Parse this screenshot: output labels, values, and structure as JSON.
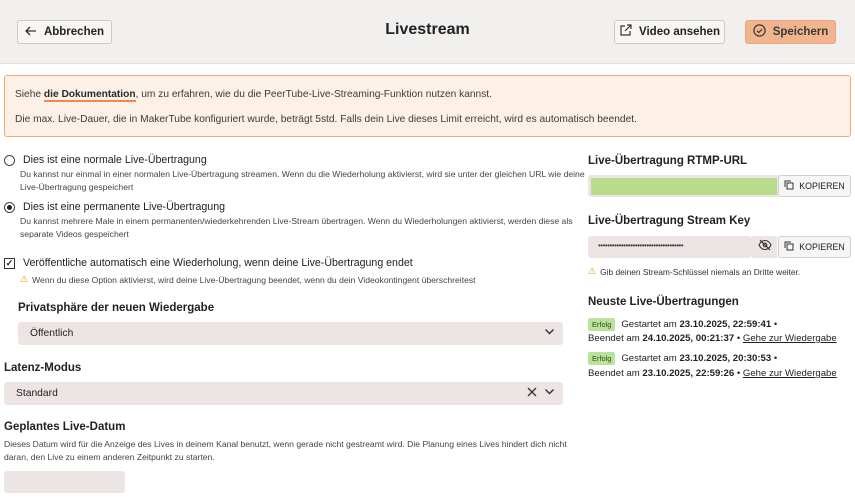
{
  "header": {
    "title": "Livestream",
    "cancel_label": "Abbrechen",
    "watch_label": "Video ansehen",
    "save_label": "Speichern"
  },
  "info": {
    "line1_prefix": "Siehe ",
    "line1_link": "die Dokumentation",
    "line1_suffix": ", um zu erfahren, wie du die PeerTube-Live-Streaming-Funktion nutzen kannst.",
    "line2": "Die max. Live-Dauer, die in MakerTube konfiguriert wurde, beträgt 5std. Falls dein Live dieses Limit erreicht, wird es automatisch beendet."
  },
  "live_type": {
    "normal_label": "Dies ist eine normale Live-Übertragung",
    "normal_desc_1": "Du kannst nur einmal in einer normalen Live-Übertragung streamen. Wenn du die Wiederholung aktivierst, wird sie unter der gleichen URL wie deine",
    "normal_desc_2": "Live-Übertragung gespeichert",
    "permanent_label": "Dies ist eine permanente Live-Übertragung",
    "permanent_desc_1": "Du kannst mehrere Male in einem permanenten/wiederkehrenden Live-Stream übertragen. Wenn du Wiederholungen aktivierst, werden diese als",
    "permanent_desc_2": "separate Videos gespeichert",
    "selected": "permanent"
  },
  "replay": {
    "label": "Veröffentliche automatisch eine Wiederholung, wenn deine Live-Übertragung endet",
    "checked": true,
    "warning": "Wenn du diese Option aktivierst, wird deine Live-Übertragung beendet, wenn du dein Videokontingent überschreitest"
  },
  "privacy": {
    "label": "Privatsphäre der neuen Wiedergabe",
    "value": "Öffentlich"
  },
  "latency": {
    "label": "Latenz-Modus",
    "value": "Standard"
  },
  "schedule": {
    "label": "Geplantes Live-Datum",
    "desc_1": "Dieses Datum wird für die Anzeige des Lives in deinem Kanal benutzt, wenn gerade nicht gestreamt wird. Die Planung eines Lives hindert dich nicht",
    "desc_2": "daran, den Live zu einem anderen Zeitpunkt zu starten.",
    "value": ""
  },
  "rtmp": {
    "label": "Live-Übertragung RTMP-URL",
    "copy_label": "KOPIEREN"
  },
  "stream_key": {
    "label": "Live-Übertragung Stream Key",
    "masked": "•••••••••••••••••••••••••••••••••••••",
    "copy_label": "KOPIEREN",
    "hint": "Gib deinen Stream-Schlüssel niemals an Dritte weiter."
  },
  "history": {
    "label": "Neuste Live-Übertragungen",
    "entries": [
      {
        "status": "Erfolg",
        "started_prefix": "Gestartet am",
        "started": "23.10.2025, 22:59:41",
        "ended_prefix": "Beendet am",
        "ended": "24.10.2025, 00:21:37",
        "link": "Gehe zur Wiedergabe"
      },
      {
        "status": "Erfolg",
        "started_prefix": "Gestartet am",
        "started": "23.10.2025, 20:30:53",
        "ended_prefix": "Beendet am",
        "ended": "23.10.2025, 22:59:26",
        "link": "Gehe zur Wiedergabe"
      }
    ]
  },
  "colors": {
    "accent": "#f08a4b",
    "save_button": "#f1b48e",
    "success_badge": "#b9e39d",
    "info_background": "#fdf0e6"
  }
}
